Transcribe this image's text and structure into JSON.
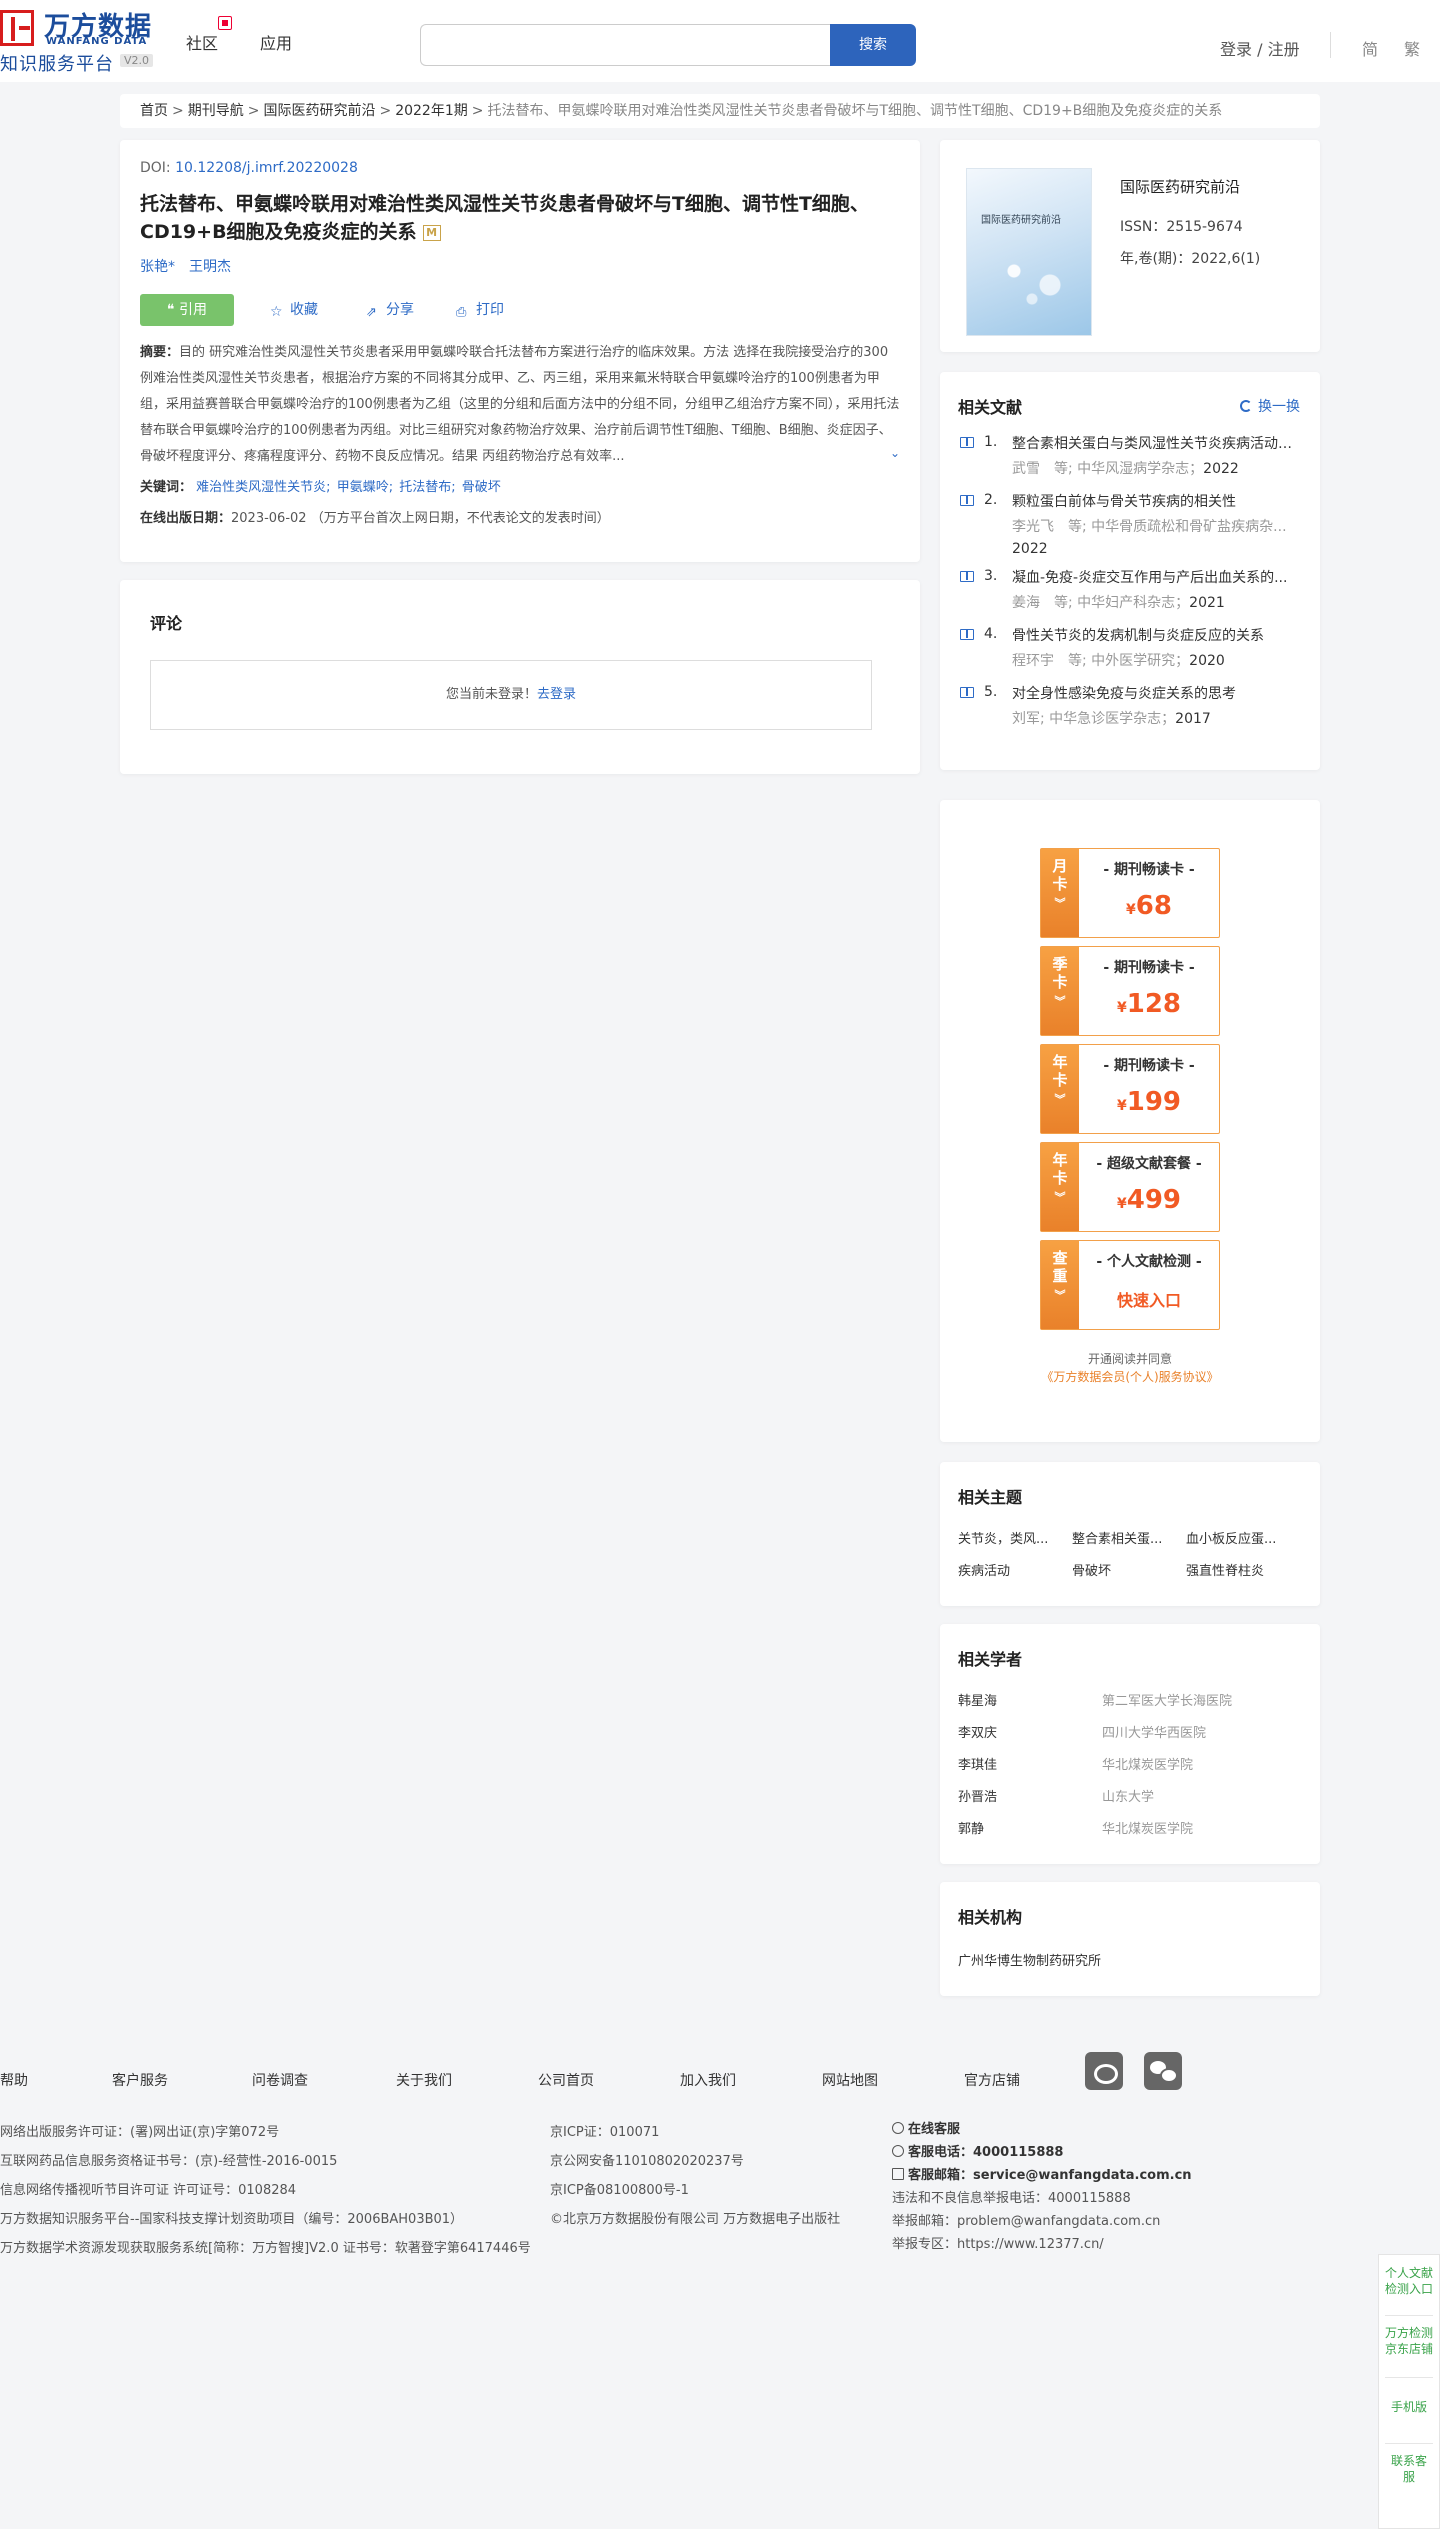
{
  "header": {
    "logo_cn": "万方数据",
    "logo_en": "WANFANG DATA",
    "logo_sub": "知识服务平台",
    "logo_version": "V2.0",
    "nav": [
      "社区",
      "应用"
    ],
    "search_placeholder": "",
    "search_button": "搜索",
    "login": "登录 / 注册",
    "lang_simplified": "简",
    "lang_traditional": "繁"
  },
  "breadcrumb": {
    "items": [
      "首页",
      "期刊导航",
      "国际医药研究前沿",
      "2022年1期"
    ],
    "current": "托法替布、甲氨蝶呤联用对难治性类风湿性关节炎患者骨破坏与T细胞、调节性T细胞、CD19+B细胞及免疫炎症的关系"
  },
  "article": {
    "doi_label": "DOI:",
    "doi": "10.12208/j.imrf.20220028",
    "title": "托法替布、甲氨蝶呤联用对难治性类风湿性关节炎患者骨破坏与T细胞、调节性T细胞、CD19+B细胞及免疫炎症的关系",
    "title_badge": "M",
    "authors": [
      "张艳*",
      "王明杰"
    ],
    "actions": {
      "cite": "引用",
      "collect": "收藏",
      "share": "分享",
      "print": "打印"
    },
    "abstract_label": "摘要：",
    "abstract": "目的 研究难治性类风湿性关节炎患者采用甲氨蝶呤联合托法替布方案进行治疗的临床效果。方法 选择在我院接受治疗的300例难治性类风湿性关节炎患者，根据治疗方案的不同将其分成甲、乙、丙三组，采用来氟米特联合甲氨蝶呤治疗的100例患者为甲组，采用益赛普联合甲氨蝶呤治疗的100例患者为乙组（这里的分组和后面方法中的分组不同，分组甲乙组治疗方案不同），采用托法替布联合甲氨蝶呤治疗的100例患者为丙组。对比三组研究对象药物治疗效果、治疗前后调节性T细胞、T细胞、B细胞、炎症因子、骨破坏程度评分、疼痛程度评分、药物不良反应情况。结果 丙组药物治疗总有效率...",
    "keywords_label": "关键词：",
    "keywords": [
      "难治性类风湿性关节炎;",
      "甲氨蝶呤;",
      "托法替布;",
      "骨破坏"
    ],
    "pubdate_label": "在线出版日期：",
    "pubdate": "2023-06-02",
    "pubdate_note": "（万方平台首次上网日期，不代表论文的发表时间）"
  },
  "comments": {
    "title": "评论",
    "not_logged": "您当前未登录！",
    "login_link": "去登录"
  },
  "journal": {
    "cover_title": "国际医药研究前沿",
    "name": "国际医药研究前沿",
    "issn": "ISSN：2515-9674",
    "volume": "年,卷(期)：2022,6(1)"
  },
  "related_docs": {
    "title": "相关文献",
    "refresh": "换一换",
    "items": [
      {
        "num": "1.",
        "title": "整合素相关蛋白与类风湿性关节炎疾病活动及...",
        "meta": "武雪　等; 中华风湿病学杂志；",
        "year": "2022"
      },
      {
        "num": "2.",
        "title": "颗粒蛋白前体与骨关节疾病的相关性",
        "meta": "李光飞　等; 中华骨质疏松和骨矿盐疾病杂...",
        "year": "2022"
      },
      {
        "num": "3.",
        "title": "凝血-免疫-炎症交互作用与产后出血关系的...",
        "meta": "姜海　等; 中华妇产科杂志；",
        "year": "2021"
      },
      {
        "num": "4.",
        "title": "骨性关节炎的发病机制与炎症反应的关系",
        "meta": "程环宇　等; 中外医学研究；",
        "year": "2020"
      },
      {
        "num": "5.",
        "title": "对全身性感染免疫与炎症关系的思考",
        "meta": "刘军; 中华急诊医学杂志；",
        "year": "2017"
      }
    ]
  },
  "vip": {
    "cards": [
      {
        "tag": [
          "月",
          "卡"
        ],
        "name": "- 期刊畅读卡 -",
        "currency": "¥",
        "price": "68"
      },
      {
        "tag": [
          "季",
          "卡"
        ],
        "name": "- 期刊畅读卡 -",
        "currency": "¥",
        "price": "128"
      },
      {
        "tag": [
          "年",
          "卡"
        ],
        "name": "- 期刊畅读卡 -",
        "currency": "¥",
        "price": "199"
      },
      {
        "tag": [
          "年",
          "卡"
        ],
        "name": "- 超级文献套餐 -",
        "currency": "¥",
        "price": "499"
      },
      {
        "tag": [
          "查",
          "重"
        ],
        "name": "- 个人文献检测 -",
        "link": "快速入口"
      }
    ],
    "note": "开通阅读并同意",
    "agreement": "《万方数据会员(个人)服务协议》",
    "accent": "#f15a24"
  },
  "topics": {
    "title": "相关主题",
    "items": [
      "关节炎，类风...",
      "整合素相关蛋...",
      "血小板反应蛋...",
      "疾病活动",
      "骨破坏",
      "强直性脊柱炎"
    ]
  },
  "scholars": {
    "title": "相关学者",
    "items": [
      {
        "name": "韩星海",
        "org": "第二军医大学长海医院"
      },
      {
        "name": "李双庆",
        "org": "四川大学华西医院"
      },
      {
        "name": "李琪佳",
        "org": "华北煤炭医学院"
      },
      {
        "name": "孙晋浩",
        "org": "山东大学"
      },
      {
        "name": "郭静",
        "org": "华北煤炭医学院"
      }
    ]
  },
  "orgs": {
    "title": "相关机构",
    "items": [
      "广州华博生物制药研究所"
    ]
  },
  "footer": {
    "nav": [
      "帮助",
      "客户服务",
      "问卷调查",
      "关于我们",
      "公司首页",
      "加入我们",
      "网站地图",
      "官方店铺"
    ],
    "col1": [
      "网络出版服务许可证：(署)网出证(京)字第072号",
      "互联网药品信息服务资格证书号：(京)-经营性-2016-0015",
      "信息网络传播视听节目许可证 许可证号：0108284",
      "万方数据知识服务平台--国家科技支撑计划资助项目（编号：2006BAH03B01）",
      "万方数据学术资源发现获取服务系统[简称：万方智搜]V2.0 证书号：软著登字第6417446号"
    ],
    "col2": [
      "京ICP证：010071",
      "京公网安备11010802020237号",
      "京ICP备08100800号-1",
      "©北京万方数据股份有限公司 万方数据电子出版社"
    ],
    "online_service": "在线客服",
    "phone_label": "客服电话：",
    "phone": "4000115888",
    "email_label": "客服邮箱：",
    "email": "service@wanfangdata.com.cn",
    "report_phone": "违法和不良信息举报电话：4000115888",
    "report_email": "举报邮箱：problem@wanfangdata.com.cn",
    "report_site": "举报专区：https://www.12377.cn/"
  },
  "float_side": {
    "items": [
      "个人文献检测入口",
      "万方检测京东店铺",
      "手机版",
      "联系客服"
    ]
  }
}
